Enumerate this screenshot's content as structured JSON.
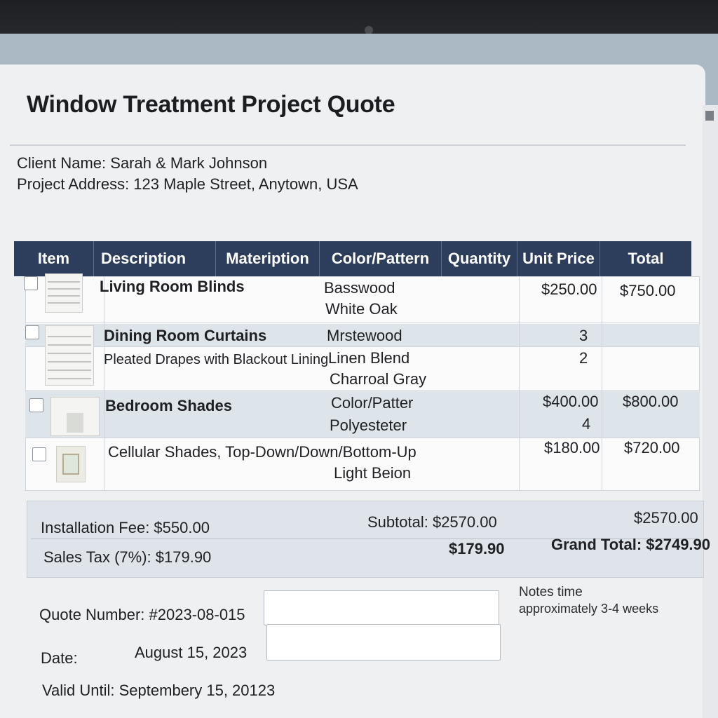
{
  "title": "Window Treatment Project Quote",
  "client": {
    "name_line": "Client Name: Sarah & Mark Johnson",
    "address_line": "Project Address: 123 Maple Street, Anytown, USA"
  },
  "table": {
    "headers": [
      "Item",
      "Description",
      "Mateription",
      "Color/Pattern",
      "Quantity",
      "Unit Price",
      "Total"
    ],
    "rows": [
      {
        "item": "Living Room Blinds",
        "material": [
          "Basswood",
          "White Oak"
        ],
        "unit_price": "$250.00",
        "total": "$750.00"
      },
      {
        "item": "Dining Room Curtains",
        "description": "Pleated Drapes with Blackout Lining",
        "material": [
          "Mrstewood",
          "Linen Blend",
          "Charroal Gray"
        ],
        "quantity": [
          "3",
          "2"
        ]
      },
      {
        "item": "Bedroom Shades",
        "material": [
          "Color/Patter",
          "Polyesteter"
        ],
        "quantity": "4",
        "unit_price": "$400.00",
        "total": "$800.00"
      },
      {
        "description": "Cellular Shades, Top-Down/Down/Bottom-Up",
        "material": [
          "Light Beion"
        ],
        "unit_price": "$180.00",
        "total": "$720.00"
      }
    ]
  },
  "totals": {
    "installation": "Installation Fee: $550.00",
    "subtotal": "Subtotal: $2570.00",
    "subtotal_value": "$2570.00",
    "sales_tax": "Sales Tax (7%): $179.90",
    "tax_value": "$179.90",
    "grand_total": "Grand Total: $2749.90"
  },
  "footer": {
    "quote_number": "Quote Number: #2023-08-015",
    "date_label": "Date:",
    "date_value": "August 15, 2023",
    "valid_until": "Valid Until: Septembery 15, 20123",
    "notes_title": "Notes time",
    "notes_text": "approximately 3-4 weeks"
  }
}
